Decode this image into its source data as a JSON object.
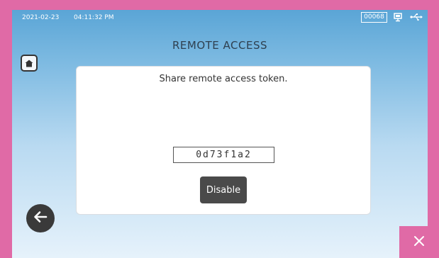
{
  "status_bar": {
    "date": "2021-02-23",
    "time": "04:11:32 PM",
    "counter": "00068",
    "icons": [
      "monitor-icon",
      "usb-icon"
    ]
  },
  "page": {
    "title": "REMOTE ACCESS",
    "home_icon": "home-icon",
    "back_icon": "back-arrow-icon",
    "close_icon": "close-icon"
  },
  "dialog": {
    "message": "Share remote access token.",
    "token": "0d73f1a2",
    "disable_label": "Disable"
  },
  "colors": {
    "frame_accent": "#e06aa6",
    "screen_top": "#5aa5d6",
    "screen_bottom": "#e6f2fb",
    "button_dark": "#4a4a4a"
  }
}
